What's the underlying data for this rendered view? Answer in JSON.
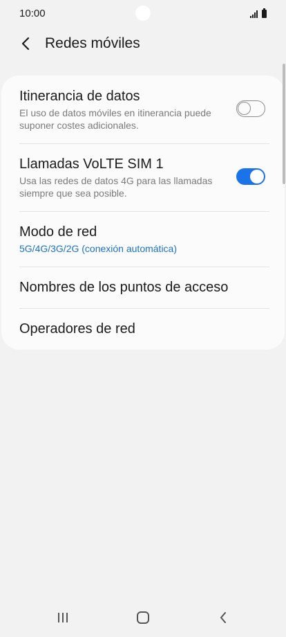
{
  "status_bar": {
    "time": "10:00"
  },
  "header": {
    "title": "Redes móviles",
    "back_icon": "chevron-left-icon"
  },
  "settings": {
    "roaming": {
      "title": "Itinerancia de datos",
      "description": "El uso de datos móviles en itinerancia puede suponer costes adicionales.",
      "enabled": false
    },
    "volte": {
      "title": "Llamadas VoLTE SIM 1",
      "description": "Usa las redes de datos 4G para las llamadas siempre que sea posible.",
      "enabled": true
    },
    "network_mode": {
      "title": "Modo de red",
      "value": "5G/4G/3G/2G (conexión automática)"
    },
    "apn": {
      "title": "Nombres de los puntos de acceso"
    },
    "operators": {
      "title": "Operadores de red"
    }
  },
  "nav_bar": {
    "recents_icon": "recents-icon",
    "home_icon": "home-icon",
    "back_icon": "back-icon"
  },
  "colors": {
    "accent": "#1a73e8",
    "link_value": "#1a73c9",
    "background": "#f2f2f2",
    "card": "#fbfbfb"
  }
}
